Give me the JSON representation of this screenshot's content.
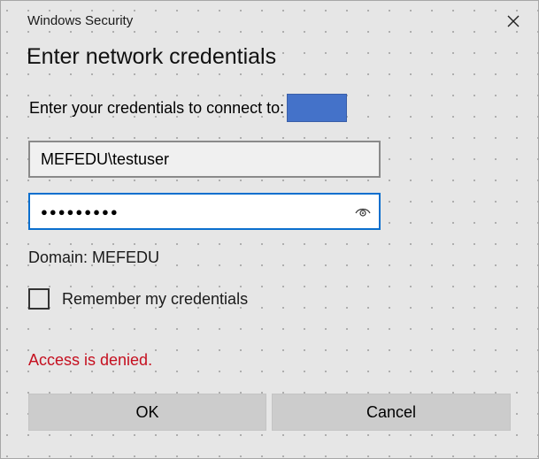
{
  "window": {
    "title": "Windows Security"
  },
  "dialog": {
    "heading": "Enter network credentials",
    "connect_prompt": "Enter your credentials to connect to:",
    "server_highlight_color": "#4472c9",
    "username_value": "MEFEDU\\testuser",
    "password_masked": "●●●●●●●●●",
    "domain_label": "Domain: MEFEDU",
    "remember_label": "Remember my credentials",
    "remember_checked": false,
    "error_message": "Access is denied.",
    "error_color": "#c50f1f"
  },
  "buttons": {
    "ok_label": "OK",
    "cancel_label": "Cancel"
  },
  "icons": {
    "close": "close-icon",
    "reveal_password": "eye-icon"
  }
}
